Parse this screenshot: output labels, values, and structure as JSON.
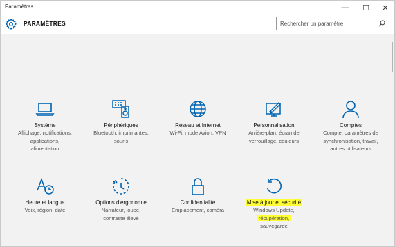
{
  "window": {
    "title": "Paramètres",
    "controls": {
      "minimize": "—",
      "maximize": "☐",
      "close": "✕"
    }
  },
  "header": {
    "icon": "gear-icon",
    "title": "PARAMÈTRES",
    "search_placeholder": "Rechercher un paramètre"
  },
  "accent_color": "#0063b1",
  "highlight_color": "#ffff33",
  "tiles": [
    {
      "icon": "laptop-icon",
      "name": "Système",
      "desc": [
        "Affichage, notifications,",
        "applications,",
        "alimentation"
      ]
    },
    {
      "icon": "keyboard-speaker-icon",
      "name": "Périphériques",
      "desc": [
        "Bluetooth, imprimantes,",
        "souris"
      ]
    },
    {
      "icon": "globe-icon",
      "name": "Réseau et Internet",
      "desc": [
        "Wi-Fi, mode Avion, VPN"
      ]
    },
    {
      "icon": "paint-monitor-icon",
      "name": "Personnalisation",
      "desc": [
        "Arrière-plan, écran de",
        "verrouillage, couleurs"
      ]
    },
    {
      "icon": "person-icon",
      "name": "Comptes",
      "desc": [
        "Compte, paramètres de",
        "synchronisation, travail,",
        "autres utilisateurs"
      ]
    },
    {
      "icon": "clock-language-icon",
      "name": "Heure et langue",
      "desc": [
        "Voix, région, date"
      ]
    },
    {
      "icon": "ease-of-access-icon",
      "name": "Options d'ergonomie",
      "desc": [
        "Narrateur, loupe,",
        "contraste élevé"
      ]
    },
    {
      "icon": "lock-icon",
      "name": "Confidentialité",
      "desc": [
        "Emplacement, caméra"
      ]
    },
    {
      "icon": "refresh-icon",
      "name": "Mise à jour et sécurité",
      "desc": [
        "Windows Update,",
        "récupération,",
        "sauvegarde"
      ]
    }
  ]
}
